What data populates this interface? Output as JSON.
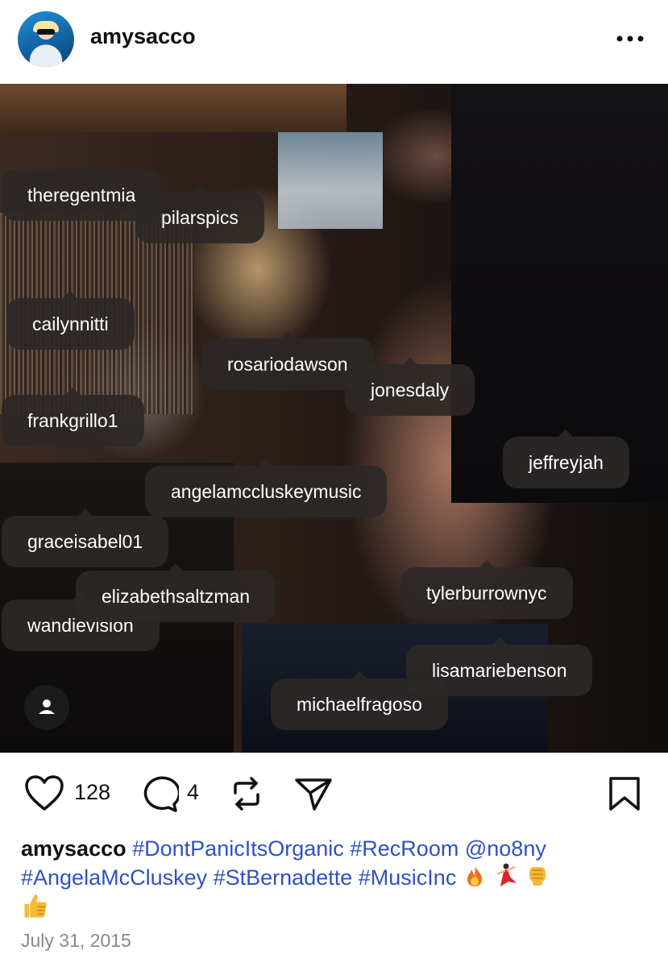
{
  "header": {
    "username": "amysacco"
  },
  "photo_tags": [
    "theregentmia",
    "pilarspics",
    "cailynnitti",
    "rosariodawson",
    "jonesdaly",
    "frankgrillo1",
    "jeffreyjah",
    "angelamccluskeymusic",
    "graceisabel01",
    "elizabethsaltzman",
    "wandievision",
    "tylerburrownyc",
    "lisamariebenson",
    "michaelfragoso"
  ],
  "actions": {
    "likes": "128",
    "comments": "4"
  },
  "caption": {
    "user": "amysacco",
    "tags": [
      "#DontPanicItsOrganic",
      "#RecRoom",
      "@no8ny",
      "#AngelaMcCluskey",
      "#StBernadette",
      "#MusicInc"
    ]
  },
  "date": "July 31, 2015",
  "colors": {
    "link": "#2f51c4",
    "tag_bg": "#2c2826"
  }
}
